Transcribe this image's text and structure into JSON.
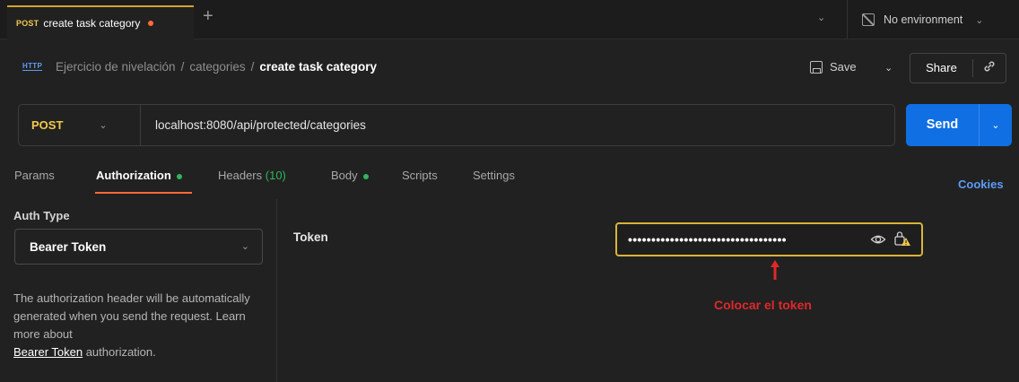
{
  "tab": {
    "method": "POST",
    "title": "create task category",
    "new_tab_icon": "+",
    "dropdown_icon": "chevron-down-icon"
  },
  "environment": {
    "label": "No environment",
    "icon": "no-environment-icon"
  },
  "breadcrumb": {
    "icon": "HTTP",
    "collection": "Ejercicio de nivelación",
    "folder": "categories",
    "request": "create task category",
    "separator": "/"
  },
  "actions": {
    "save_label": "Save",
    "share_label": "Share",
    "link_icon": "link-icon"
  },
  "request": {
    "method": "POST",
    "url": "localhost:8080/api/protected/categories",
    "send_label": "Send"
  },
  "request_tabs": [
    {
      "label": "Params"
    },
    {
      "label": "Authorization",
      "active": true
    },
    {
      "label": "Headers",
      "count": "(10)"
    },
    {
      "label": "Body"
    },
    {
      "label": "Scripts"
    },
    {
      "label": "Settings"
    }
  ],
  "cookies_label": "Cookies",
  "auth": {
    "type_label": "Auth Type",
    "type_value": "Bearer Token",
    "description": "The authorization header will be automatically generated when you send the request. Learn more about",
    "description_link": "Bearer Token",
    "description_suffix": " authorization.",
    "token_label": "Token",
    "token_value": "••••••••••••••••••••••••••••••••••"
  },
  "annotation": {
    "text": "Colocar el token",
    "color": "#e0282a"
  },
  "colors": {
    "accent_orange": "#ff6c37",
    "send_blue": "#0f6fe3",
    "method_yellow": "#f2c94c",
    "highlight_border": "#d9b43a",
    "status_green": "#2fb65a"
  }
}
